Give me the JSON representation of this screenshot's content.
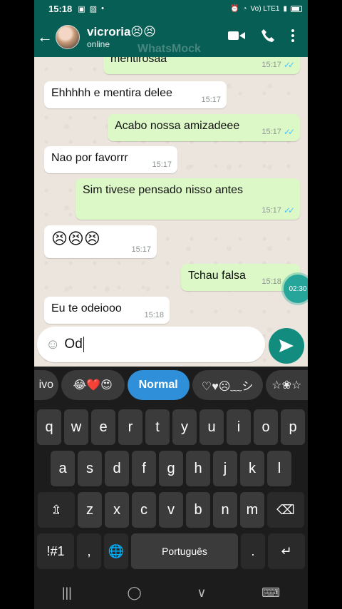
{
  "statusbar": {
    "time": "15:18",
    "signal_text": "Vo) LTE1"
  },
  "header": {
    "contact_name": "vicroria😣😣",
    "status": "online",
    "watermark": "WhatsMock",
    "icons": [
      "back-arrow-icon",
      "video-call-icon",
      "phone-icon",
      "more-options-icon"
    ]
  },
  "messages": [
    {
      "dir": "out",
      "text": "mentirosaa",
      "time": "15:17",
      "read": true
    },
    {
      "dir": "in",
      "text": "Ehhhhh  e mentira delee",
      "time": "15:17"
    },
    {
      "dir": "out",
      "text": "Acabo nossa amizadeee",
      "time": "15:17",
      "read": true
    },
    {
      "dir": "in",
      "text": "Nao por favorrr",
      "time": "15:17"
    },
    {
      "dir": "out",
      "text": "Sim tivese pensado nisso antes",
      "time": "15:17",
      "read": true
    },
    {
      "dir": "in",
      "text": "😣😣😣",
      "time": "15:17"
    },
    {
      "dir": "out",
      "text": "Tchau falsa",
      "time": "15:18",
      "read": true
    },
    {
      "dir": "in",
      "text": "Eu te odeiooo",
      "time": "15:18"
    }
  ],
  "recording_timer": "02:30",
  "composer": {
    "value": "Od"
  },
  "keyboard": {
    "suggestions": [
      "ivo",
      "😂❤️😍",
      "Normal",
      "♡♥☹︎﹏シ",
      "☆❀☆"
    ],
    "active_suggestion": "Normal",
    "rows": [
      [
        "q",
        "w",
        "e",
        "r",
        "t",
        "y",
        "u",
        "i",
        "o",
        "p"
      ],
      [
        "a",
        "s",
        "d",
        "f",
        "g",
        "h",
        "j",
        "k",
        "l"
      ],
      [
        "z",
        "x",
        "c",
        "v",
        "b",
        "n",
        "m"
      ]
    ],
    "shift_label": "⇫",
    "backspace_label": "⌫",
    "symbols_label": "!#1",
    "comma_label": ",",
    "globe_label": "🌐",
    "space_label": "Português",
    "period_label": ".",
    "enter_label": "↵"
  },
  "navbar": {
    "recents_label": "|||",
    "home_label": "◯",
    "back_label": "∨",
    "keyboard_label": "⌨"
  }
}
